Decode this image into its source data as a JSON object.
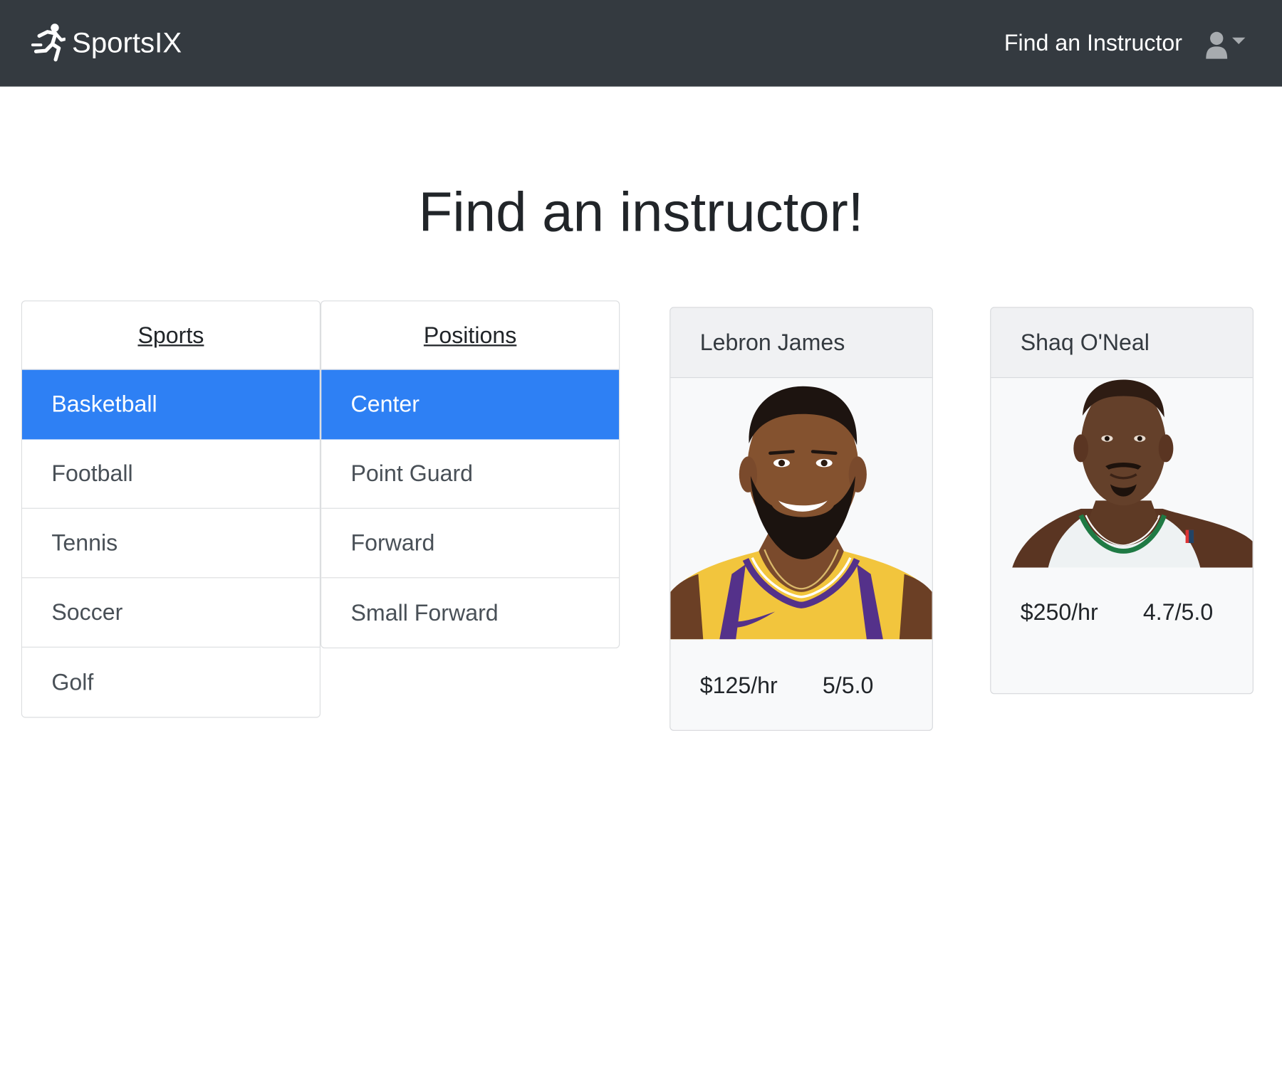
{
  "navbar": {
    "brand_name": "SportsIX",
    "brand_icon": "running-person-icon",
    "nav_link": "Find an Instructor",
    "user_icon": "user-icon",
    "dropdown_icon": "caret-down-icon"
  },
  "page": {
    "title": "Find an instructor!"
  },
  "sports": {
    "header": "Sports",
    "items": [
      {
        "label": "Basketball",
        "active": true
      },
      {
        "label": "Football",
        "active": false
      },
      {
        "label": "Tennis",
        "active": false
      },
      {
        "label": "Soccer",
        "active": false
      },
      {
        "label": "Golf",
        "active": false
      }
    ]
  },
  "positions": {
    "header": "Positions",
    "items": [
      {
        "label": "Center",
        "active": true
      },
      {
        "label": "Point Guard",
        "active": false
      },
      {
        "label": "Forward",
        "active": false
      },
      {
        "label": "Small Forward",
        "active": false
      }
    ]
  },
  "instructors": [
    {
      "name": "Lebron James",
      "price": "$125/hr",
      "rating": "5/5.0"
    },
    {
      "name": "Shaq O'Neal",
      "price": "$250/hr",
      "rating": "4.7/5.0"
    }
  ],
  "colors": {
    "navbar_bg": "#343a40",
    "active_bg": "#2e80f4",
    "card_bg": "#f8f9fa"
  }
}
